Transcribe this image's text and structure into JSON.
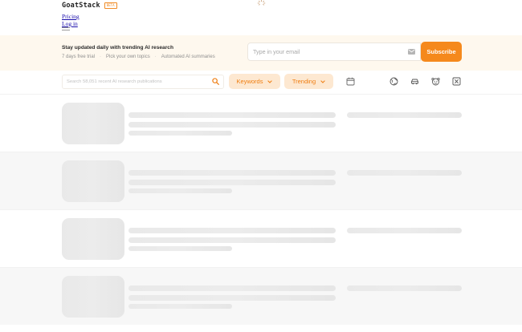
{
  "header": {
    "brand": "GoatStack",
    "badge": "BETA",
    "nav": [
      {
        "label": "Pricing"
      },
      {
        "label": "Log in"
      }
    ],
    "menu_icon": "hamburger-icon",
    "loading_icon": "spinner-icon"
  },
  "banner": {
    "title": "Stay updated daily with trending AI research",
    "features": [
      "7 days free trial",
      "Pick your own topics",
      "Automated AI summaries"
    ],
    "email_placeholder": "Type in your email",
    "subscribe_label": "Subscribe",
    "mail_icon": "mail-icon"
  },
  "filters": {
    "search_placeholder": "Search 58,051 recent AI research publications",
    "keywords_label": "Keywords",
    "sort_label": "Trending",
    "icons": [
      "calendar-icon",
      "globe-icon",
      "car-icon",
      "emoji-icon",
      "x-icon"
    ]
  },
  "colors": {
    "accent": "#f5891c",
    "pill_bg": "#fde8d1",
    "banner_bg": "#fef8ee",
    "skeleton": "#e9e9e9"
  },
  "feed": {
    "state": "loading",
    "placeholder_rows": 4
  }
}
